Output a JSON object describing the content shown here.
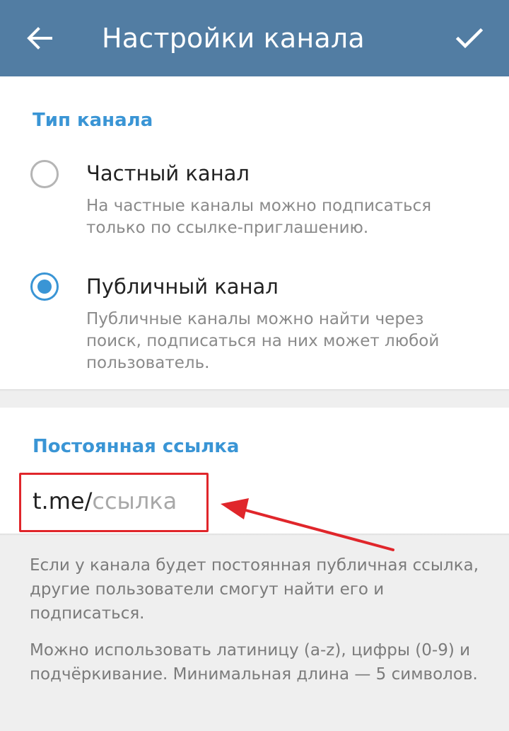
{
  "header": {
    "title": "Настройки канала",
    "back_icon": "arrow-left-icon",
    "confirm_icon": "checkmark-icon",
    "background_color": "#527da3"
  },
  "channel_type": {
    "section_title": "Тип канала",
    "options": [
      {
        "label": "Частный канал",
        "description": "На частные каналы можно подписаться только по ссылке-приглашению.",
        "selected": false
      },
      {
        "label": "Публичный канал",
        "description": "Публичные каналы можно найти через поиск, подписаться на них может любой пользователь.",
        "selected": true
      }
    ]
  },
  "permanent_link": {
    "section_title": "Постоянная ссылка",
    "prefix": "t.me/",
    "placeholder": "ссылка",
    "info_1": "Если у канала будет постоянная публичная ссылка, другие пользователи смогут найти его и подписаться.",
    "info_2": "Можно использовать латиницу (a-z), цифры (0-9) и подчёркивание. Минимальная длина — 5 символов."
  },
  "colors": {
    "accent": "#3a95d5",
    "annotation": "#e0262b"
  }
}
